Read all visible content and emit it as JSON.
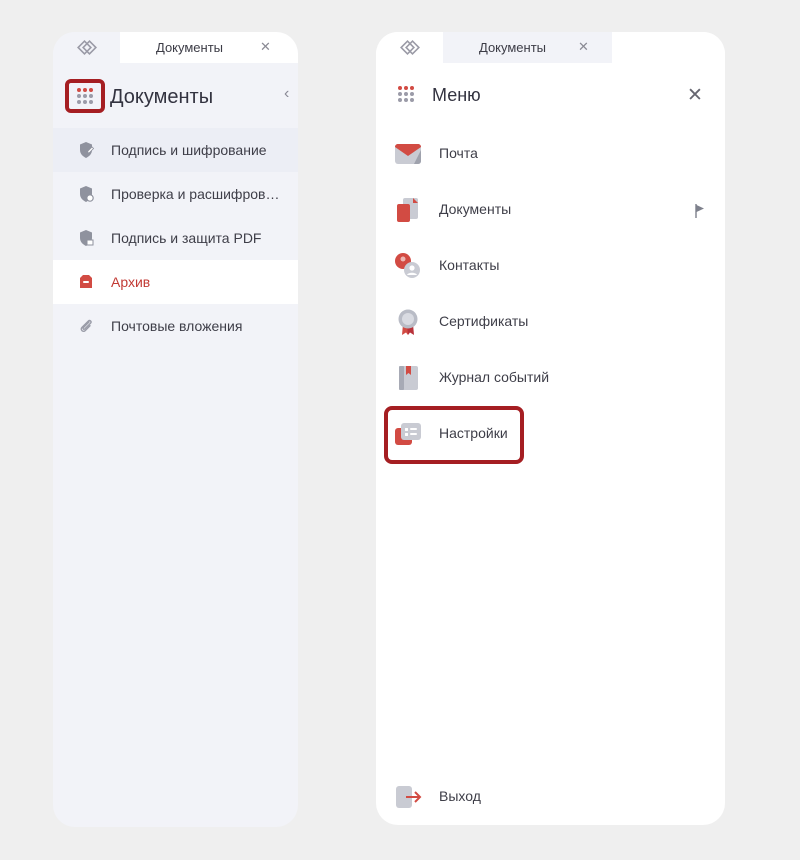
{
  "left": {
    "tab": {
      "label": "Документы",
      "close": "✕"
    },
    "header": {
      "title": "Документы",
      "collapse": "‹"
    },
    "nav": [
      {
        "label": "Подпись и шифрование",
        "icon": "shield-pen-icon"
      },
      {
        "label": "Проверка и расшифров…",
        "icon": "shield-check-icon"
      },
      {
        "label": "Подпись и защита PDF",
        "icon": "shield-pdf-icon"
      },
      {
        "label": "Архив",
        "icon": "archive-icon",
        "active": true
      },
      {
        "label": "Почтовые вложения",
        "icon": "paperclip-icon"
      }
    ]
  },
  "right": {
    "tab": {
      "label": "Документы",
      "close": "✕"
    },
    "header": {
      "title": "Меню",
      "close": "✕"
    },
    "menu": [
      {
        "label": "Почта",
        "icon": "mail-icon"
      },
      {
        "label": "Документы",
        "icon": "documents-icon"
      },
      {
        "label": "Контакты",
        "icon": "contacts-icon"
      },
      {
        "label": "Сертификаты",
        "icon": "certificate-icon"
      },
      {
        "label": "Журнал событий",
        "icon": "journal-icon"
      },
      {
        "label": "Настройки",
        "icon": "settings-icon"
      }
    ],
    "logout": {
      "label": "Выход",
      "icon": "logout-icon"
    }
  },
  "colors": {
    "accent": "#c23a34",
    "highlight": "#a51e22",
    "icon_gray": "#8f929e"
  }
}
